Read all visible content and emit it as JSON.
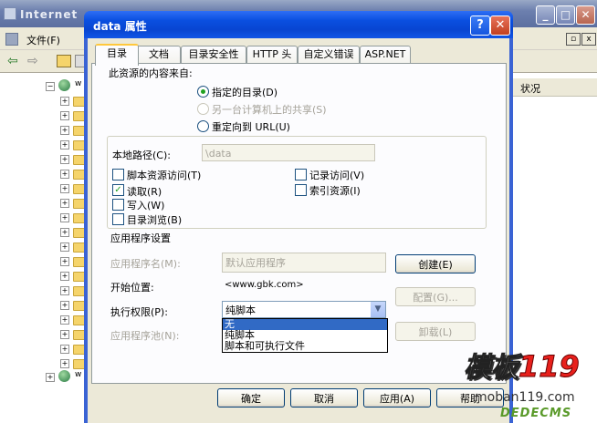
{
  "background_window": {
    "title": "Internet",
    "menu_file": "文件(F)",
    "column_status": "状况",
    "tree_node_w1": "w",
    "tree_node_w2": "w"
  },
  "dialog": {
    "title": "data 属性",
    "help_btn": "?",
    "close_btn": "✕",
    "tabs": [
      "目录",
      "文档",
      "目录安全性",
      "HTTP 头",
      "自定义错误",
      "ASP.NET"
    ],
    "source_heading": "此资源的内容来自:",
    "source_options": [
      {
        "label": "指定的目录(D)",
        "selected": true,
        "enabled": true
      },
      {
        "label": "另一台计算机上的共享(S)",
        "selected": false,
        "enabled": false
      },
      {
        "label": "重定向到 URL(U)",
        "selected": false,
        "enabled": true
      }
    ],
    "local_path_label": "本地路径(C):",
    "local_path_value": "\\data",
    "checkboxes_left": [
      {
        "label": "脚本资源访问(T)",
        "checked": false
      },
      {
        "label": "读取(R)",
        "checked": true
      },
      {
        "label": "写入(W)",
        "checked": false
      },
      {
        "label": "目录浏览(B)",
        "checked": false
      }
    ],
    "checkboxes_right": [
      {
        "label": "记录访问(V)",
        "checked": false
      },
      {
        "label": "索引资源(I)",
        "checked": false
      }
    ],
    "app_settings_heading": "应用程序设置",
    "app_name_label": "应用程序名(M):",
    "app_name_value": "默认应用程序",
    "create_button": "创建(E)",
    "start_point_label": "开始位置:",
    "start_point_value": "<www.gbk.com>",
    "exec_perm_label": "执行权限(P):",
    "exec_perm_value": "纯脚本",
    "config_button": "配置(G)...",
    "app_pool_label": "应用程序池(N):",
    "unload_button": "卸载(L)",
    "exec_perm_options": [
      "无",
      "纯脚本",
      "脚本和可执行文件"
    ],
    "exec_perm_highlight": "无",
    "ok_button": "确定",
    "cancel_button": "取消",
    "apply_button": "应用(A)",
    "help_button": "帮助"
  },
  "watermark": {
    "brand_cn": "模板",
    "brand_num": "119",
    "url": "moban119.com",
    "tag": "DEDECMS"
  },
  "colors": {
    "title_blue": "#0a4fe0",
    "dialog_bg": "#ece9d8",
    "selection": "#316ac5",
    "watermark_red": "#e8201c"
  }
}
